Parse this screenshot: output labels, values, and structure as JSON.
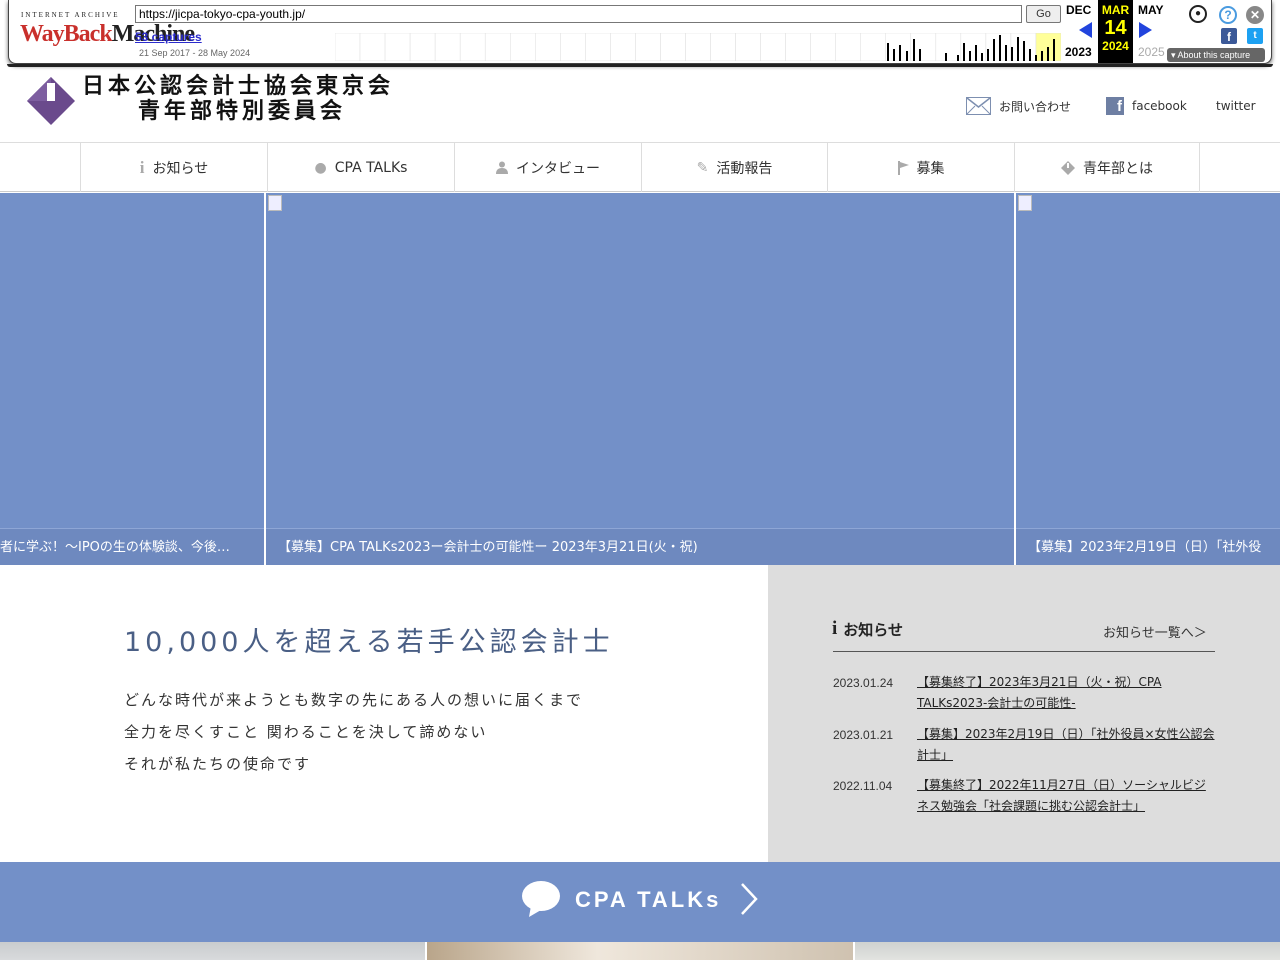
{
  "wayback": {
    "logo_top": "INTERNET ARCHIVE",
    "logo_a": "WayBack",
    "logo_b": "Machine",
    "url": "https://jicpa-tokyo-cpa-youth.jp/",
    "go_label": "Go",
    "captures": "53 captures",
    "range": "21 Sep 2017 - 28 May 2024",
    "prev_month": "DEC",
    "prev_year": "2023",
    "cur_month": "MAR",
    "cur_day": "14",
    "cur_year": "2024",
    "next_month": "MAY",
    "next_year": "2025",
    "about": "About this capture"
  },
  "site": {
    "title_line1": "日本公認会計士協会東京会",
    "title_line2": "青年部特別委員会"
  },
  "header_links": {
    "contact": "お問い合わせ",
    "facebook": "facebook",
    "twitter": "twitter"
  },
  "nav": [
    {
      "label": "お知らせ",
      "icon": "info-icon"
    },
    {
      "label": "CPA TALKs",
      "icon": "speech-bubble-icon"
    },
    {
      "label": "インタビュー",
      "icon": "person-icon"
    },
    {
      "label": "活動報告",
      "icon": "pencil-icon"
    },
    {
      "label": "募集",
      "icon": "flag-icon"
    },
    {
      "label": "青年部とは",
      "icon": "diamond-icon"
    }
  ],
  "slides": [
    "者に学ぶ！～IPOの生の体験談、今後…",
    "【募集】CPA TALKs2023ー会計士の可能性ー 2023年3月21日(火・祝)",
    "【募集】2023年2月19日（日）「社外役"
  ],
  "intro": {
    "heading": "10,000人を超える若手公認会計士",
    "lines": [
      "どんな時代が来ようとも数字の先にある人の想いに届くまで",
      "全力を尽くすこと 関わることを決して諦めない",
      "それが私たちの使命です"
    ]
  },
  "news": {
    "title": "お知らせ",
    "more": "お知らせ一覧へ＞",
    "items": [
      {
        "date": "2023.01.24",
        "text": "【募集終了】2023年3月21日（火・祝）CPA TALKs2023-会計士の可能性-"
      },
      {
        "date": "2023.01.21",
        "text": "【募集】2023年2月19日（日）「社外役員×女性公認会計士」"
      },
      {
        "date": "2022.11.04",
        "text": "【募集終了】2022年11月27日（日）ソーシャルビジネス勉強会「社会課題に挑む公認会計士」"
      }
    ]
  },
  "talks": {
    "title": "CPA TALKs"
  },
  "colors": {
    "accent": "#7390c8",
    "logo_purple": "#6a4a8c",
    "news_bg": "#dddddd",
    "heading": "#4a5f85"
  }
}
